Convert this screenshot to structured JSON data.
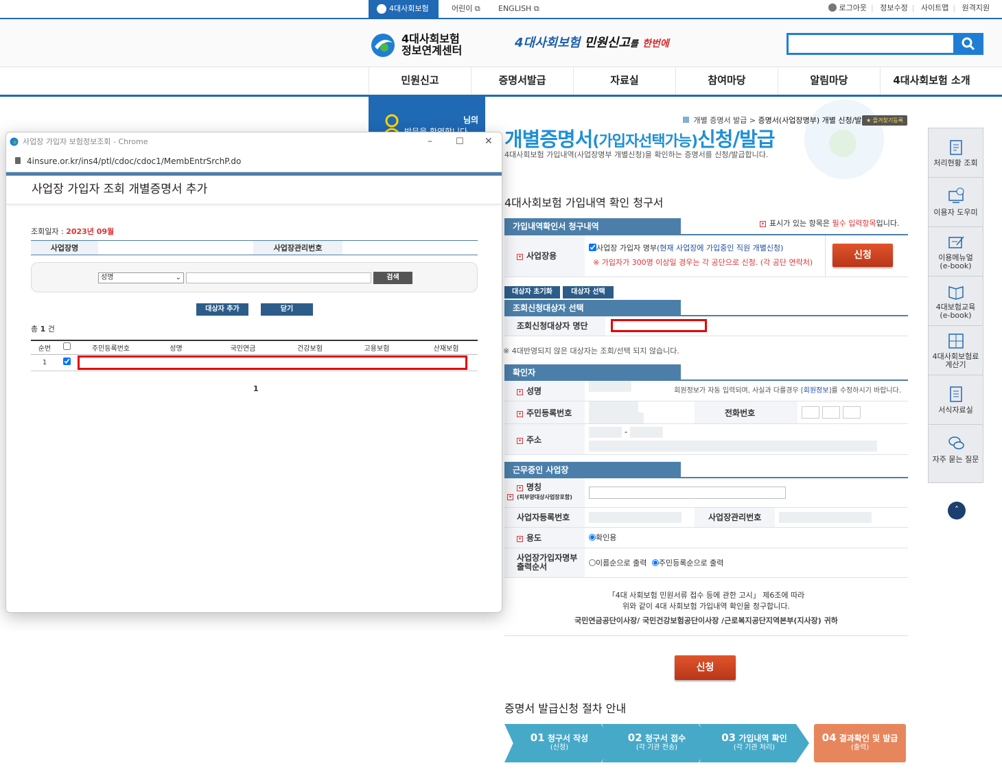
{
  "topbar": {
    "tabs": [
      "4대사회보험",
      "어린이",
      "ENGLISH"
    ],
    "util": [
      "로그아웃",
      "정보수정",
      "사이트맵",
      "원격지원"
    ]
  },
  "header": {
    "logo_line1": "4대사회보험",
    "logo_line2": "정보연계센터",
    "slogan_blue": "4대사회보험",
    "slogan_dark": "민원신고",
    "slogan_mid": "를",
    "slogan_red": "한번에",
    "search_value": ""
  },
  "gnb": [
    "민원신고",
    "증명서발급",
    "자료실",
    "참여마당",
    "알림마당",
    "4대사회보험 소개"
  ],
  "login": {
    "suffix": "님의",
    "welcome": "방문을 환영합니다"
  },
  "quick": [
    "처리현황 조회",
    "이용자 도우미",
    "이용메뉴얼",
    "(e-book)",
    "4대보험교육",
    "(e-book)",
    "4대사회보험료",
    "계산기",
    "서식자료실",
    "자주 묻는 질문"
  ],
  "main": {
    "crumb1": "개별 증명서 발급",
    "crumb2": "증명서(사업장명부) 개별 신청/발급",
    "bookmark": "즐겨찾기등록",
    "title_a": "개별증명서",
    "title_b": "(가입자선택가능)",
    "title_c": "신청/발급",
    "desc": "4대사회보험 가입내역(사업장명부 개별신청)을 확인하는 증명서를 신청/발급합니다.",
    "form_title": "4대사회보험 가입내역 확인 청구서",
    "req_note_a": "표시가 있는 항목은 ",
    "req_note_b": "필수 입력항목",
    "req_note_c": "입니다.",
    "sec1": "가입내역확인서 청구내역",
    "use_label": "사업장용",
    "use_check": "사업장 가입자 명부",
    "use_check_blue": "(현재 사업장에 가입중인 직원 개별신청)",
    "use_warn": "※ 가입자가 300명 이상일 경우는 각 공단으로 신청. (각 공단 연락처)",
    "apply_btn": "신청",
    "reset_btn": "대상자 초기화",
    "select_btn": "대상자 선택",
    "sec2": "조회신청대상자 선택",
    "target_label": "조회신청대상자 명단",
    "note_4d": "※ 4대반영되지 않은 대상자는 조회/선택 되지 않습니다.",
    "sec3": "확인자",
    "name_label": "성명",
    "name_hint_a": "회원정보가 자동 입력되며, 사실과 다를경우 [",
    "name_hint_b": "회원정보",
    "name_hint_c": "]를 수정하시기 바랍니다.",
    "rrn_label": "주민등록번호",
    "phone_label": "전화번호",
    "addr_label": "주소",
    "addr_dash": "-",
    "sec4": "근무중인 사업장",
    "biz_name_label": "명칭",
    "biz_name_sub": "(피부양대상사업장포함)",
    "biz_reg_label": "사업자등록번호",
    "biz_mgmt_label": "사업장관리번호",
    "purpose_label": "용도",
    "purpose_value": "확인용",
    "order_label_1": "사업장가입자명부",
    "order_label_2": "출력순서",
    "order_opt1": "이름순으로 출력",
    "order_opt2": "주민등록순으로 출력",
    "notice1": "「4대 사회보험 민원서류 접수 등에 관한 고시」 제6조에 따라",
    "notice2": "위와 같이 4대 사회보험 가입내역 확인을 청구합니다.",
    "notice3": "국민연금공단이사장/ 국민건강보험공단이사장 /근로복지공단지역본부(지사장) 귀하",
    "apply_btn2": "신청",
    "steps_title": "증명서 발급신청 절차 안내",
    "steps": [
      {
        "num": "01",
        "label": "청구서 작성",
        "sub": "(신청)"
      },
      {
        "num": "02",
        "label": "청구서 접수",
        "sub": "(각 기관 전송)"
      },
      {
        "num": "03",
        "label": "가입내역 확인",
        "sub": "(각 기관 처리)"
      },
      {
        "num": "04",
        "label": "결과확인 및 발급",
        "sub": "(출력)"
      }
    ]
  },
  "popup": {
    "window_title": "사업장 가입자 보험정보조회 - Chrome",
    "url": "4insure.or.kr/ins4/ptl/cdoc/cdoc1/MembEntrSrchP.do",
    "heading": "사업장 가입자 조회 개별증명서 추가",
    "date_label": "조회일자 : ",
    "date_value": "2023년 09월",
    "col_bizname": "사업장명",
    "col_bizno": "사업장관리번호",
    "select_value": "성명",
    "search_btn": "검색",
    "add_btn": "대상자 추가",
    "close_btn": "닫기",
    "total_a": "총 ",
    "total_n": "1",
    "total_b": " 건",
    "headers": [
      "순번",
      "주민등록번호",
      "성명",
      "국민연금",
      "건강보험",
      "고용보험",
      "산재보험"
    ],
    "row_no": "1",
    "page": "1"
  }
}
